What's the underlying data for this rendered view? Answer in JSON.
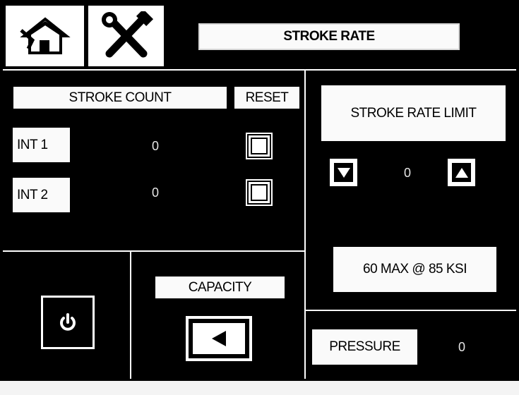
{
  "header": {
    "title": "STROKE RATE",
    "home_icon": "home-icon",
    "tools_icon": "wrench-screwdriver-icon"
  },
  "stroke_count": {
    "heading": "STROKE COUNT",
    "reset_label": "RESET",
    "rows": [
      {
        "label": "INT 1",
        "value": "0"
      },
      {
        "label": "INT 2",
        "value": "0"
      }
    ]
  },
  "stroke_rate_limit": {
    "heading": "STROKE RATE LIMIT",
    "value": "0",
    "down_icon": "arrow-down-icon",
    "up_icon": "arrow-up-icon",
    "max_label": "60 MAX @ 85 KSI"
  },
  "power": {
    "icon": "power-icon"
  },
  "capacity": {
    "label": "CAPACITY",
    "icon": "arrow-left-icon"
  },
  "pressure": {
    "label": "PRESSURE",
    "value": "0"
  },
  "colors": {
    "background": "#000000",
    "panel_text": "#ffffff",
    "label_bg": "#fafafa"
  }
}
